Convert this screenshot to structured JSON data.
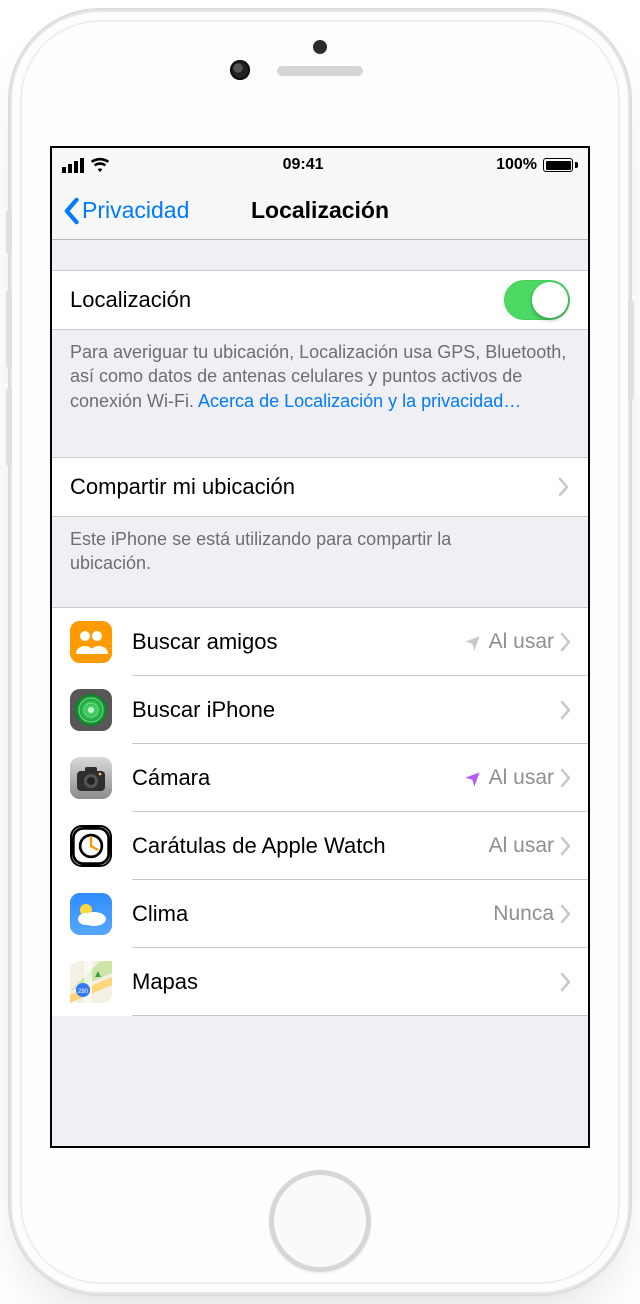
{
  "statusbar": {
    "time": "09:41",
    "battery_pct": "100%"
  },
  "nav": {
    "back": "Privacidad",
    "title": "Localización"
  },
  "toggle": {
    "label": "Localización",
    "on": true
  },
  "toggle_footer_text": "Para averiguar tu ubicación, Localización usa GPS, Bluetooth, así como datos de antenas celulares y puntos activos de conexión Wi-Fi. ",
  "toggle_footer_link": "Acerca de Localización y la privacidad…",
  "share": {
    "label": "Compartir mi ubicación",
    "footer": "Este iPhone se está utilizando para compartir la ubicación."
  },
  "apps": [
    {
      "id": "buscar-amigos",
      "name": "Buscar amigos",
      "status": "Al usar",
      "arrow": "gray",
      "icon": "friends"
    },
    {
      "id": "buscar-iphone",
      "name": "Buscar iPhone",
      "status": "",
      "arrow": "",
      "icon": "findiphone"
    },
    {
      "id": "camara",
      "name": "Cámara",
      "status": "Al usar",
      "arrow": "purple",
      "icon": "camera"
    },
    {
      "id": "caratulas-apple-watch",
      "name": "Carátulas de Apple Watch",
      "status": "Al usar",
      "arrow": "",
      "icon": "watch"
    },
    {
      "id": "clima",
      "name": "Clima",
      "status": "Nunca",
      "arrow": "",
      "icon": "weather"
    },
    {
      "id": "mapas",
      "name": "Mapas",
      "status": "",
      "arrow": "",
      "icon": "maps"
    }
  ]
}
